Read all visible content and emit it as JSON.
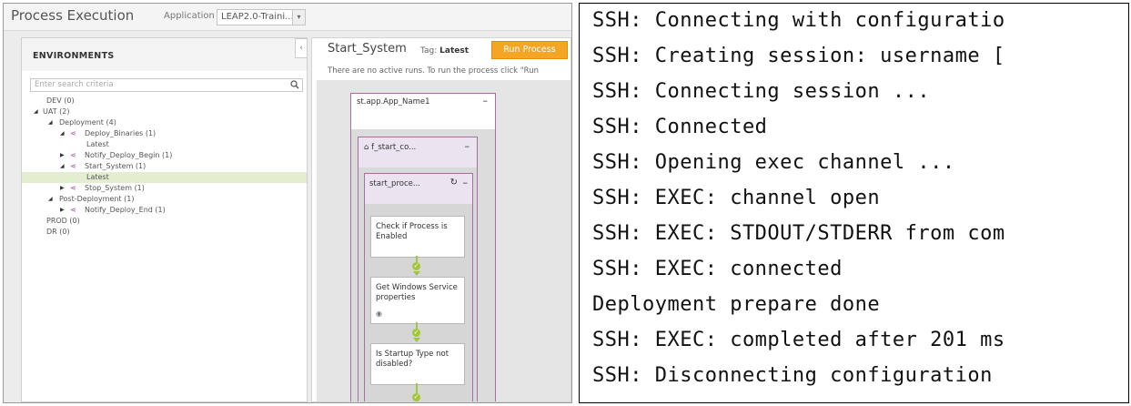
{
  "app": {
    "title": "Process Execution",
    "application_label": "Application",
    "application_value": "LEAP2.0-Traini...",
    "dropdown_glyph": "▾"
  },
  "environments": {
    "title": "ENVIRONMENTS",
    "collapse_glyph": "‹",
    "search_placeholder": "Enter search criteria",
    "search_icon": "🔍",
    "tree": [
      {
        "label": "DEV (0)"
      },
      {
        "label": "UAT (2)"
      },
      {
        "label": "Deployment (4)"
      },
      {
        "label": "Deploy_Binaries (1)"
      },
      {
        "label": "Latest"
      },
      {
        "label": "Notify_Deploy_Begin (1)"
      },
      {
        "label": "Start_System (1)"
      },
      {
        "label": "Latest"
      },
      {
        "label": "Stop_System (1)"
      },
      {
        "label": "Post-Deployment (1)"
      },
      {
        "label": "Notify_Deploy_End (1)"
      },
      {
        "label": "PROD (0)"
      },
      {
        "label": "DR (0)"
      }
    ]
  },
  "process": {
    "title": "Start_System",
    "tag_label": "Tag:",
    "tag_value": "Latest",
    "run_button": "Run Process",
    "message": "There are no active runs. To run the process click \"Run",
    "stage1": {
      "title": "st.app.App_Name1",
      "control": "–"
    },
    "stage2": {
      "title": "f_start_co...",
      "control": "–",
      "icon": "🔒"
    },
    "stage3": {
      "title": "start_proce...",
      "control": "–",
      "icon": "↻"
    },
    "steps": [
      {
        "label": "Check if Process is Enabled"
      },
      {
        "label": "Get Windows Service properties"
      },
      {
        "label": "Is Startup Type not disabled?"
      }
    ],
    "check_glyph": "✓",
    "step_marker": "◉"
  },
  "terminal": {
    "lines": [
      "SSH: Connecting with configuratio",
      "SSH: Creating session: username [",
      "SSH: Connecting session ...",
      "SSH: Connected",
      "SSH: Opening exec channel ...",
      "SSH: EXEC: channel open",
      "SSH: EXEC: STDOUT/STDERR from com",
      "SSH: EXEC: connected",
      "Deployment prepare done",
      "SSH: EXEC: completed after 201 ms",
      "SSH: Disconnecting configuration"
    ]
  }
}
